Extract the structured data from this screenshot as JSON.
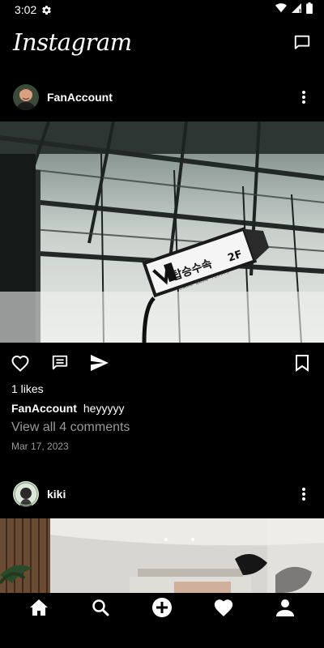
{
  "status_bar": {
    "time": "3:02"
  },
  "header": {
    "logo_text": "Instagram"
  },
  "posts": [
    {
      "username": "FanAccount",
      "likes_text": "1 likes",
      "caption_user": "FanAccount",
      "caption_text": "heyyyyy",
      "view_comments": "View all 4 comments",
      "date": "Mar 17, 2023",
      "image_sign": {
        "korean": "탑승수속",
        "floor": "2F",
        "subtext": "Check-in · 登机手续 · チェックイン"
      }
    },
    {
      "username": "kiki"
    }
  ],
  "bottom_nav": [
    "home-icon",
    "search-icon",
    "add-icon",
    "heart-icon",
    "profile-icon"
  ],
  "colors": {
    "background": "#000000",
    "text": "#ffffff",
    "secondary_text": "#9a9a9a"
  }
}
